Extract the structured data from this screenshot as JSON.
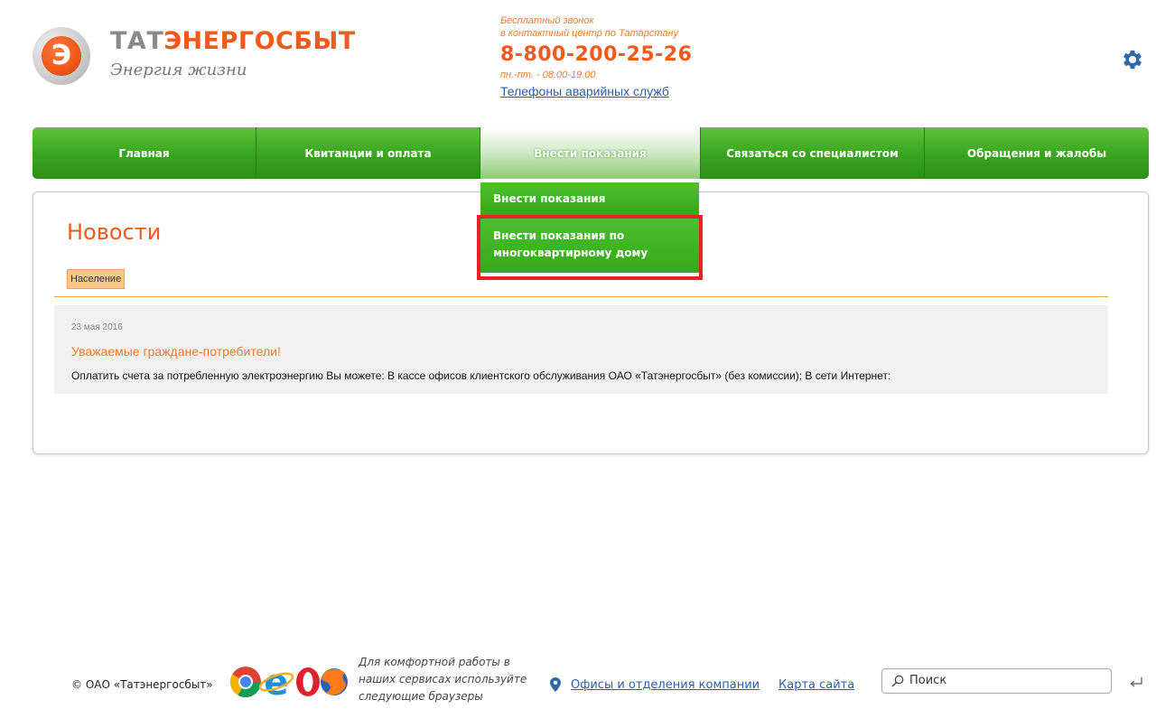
{
  "header": {
    "logo_letter": "Э",
    "brand_part1": "ТАТ",
    "brand_part2": "ЭНЕРГОСБЫТ",
    "slogan": "Энергия жизни",
    "free_call_line1": "Бесплатный звонок",
    "free_call_line2": "в контактный центр по Татарстану",
    "phone": "8-800-200-25-26",
    "hours": "пн.-пт. - 08.00-19.00",
    "emergency_link": "Телефоны аварийных служб",
    "settings_icon": "gear-icon"
  },
  "nav": {
    "items": [
      {
        "label": "Главная",
        "width": 248
      },
      {
        "label": "Квитанции и оплата",
        "width": 248
      },
      {
        "label": "Внести показания",
        "width": 244,
        "active": true
      },
      {
        "label": "Связаться со специалистом",
        "width": 248
      },
      {
        "label": "Обращения и жалобы",
        "width": 248
      }
    ]
  },
  "dropdown": {
    "item1": "Внести показания",
    "item2": "Внести показания по многоквартирному дому"
  },
  "content": {
    "title": "Новости",
    "tag": "Население",
    "news": {
      "date": "23 мая 2016",
      "headline": "Уважаемые граждане-потребители!",
      "text": "Оплатить счета за потребленную электроэнергию Вы можете: В кассе офисов клиентского обслуживания ОАО «Татэнергосбыт» (без комиссии); В сети Интернет:"
    }
  },
  "footer": {
    "copyright": "© ОАО «Татэнергосбыт»",
    "browsers_note_line1": "Для комфортной работы в",
    "browsers_note_line2": "наших сервисах используйте",
    "browsers_note_line3": "следующие браузеры",
    "offices_link": "Офисы и отделения компании",
    "sitemap_link": "Карта сайта",
    "search_placeholder": "Поиск",
    "colors": {
      "accent": "#f05a1a",
      "green": "#3ba620",
      "link": "#2b5fa5",
      "highlight": "#e8202a"
    }
  }
}
